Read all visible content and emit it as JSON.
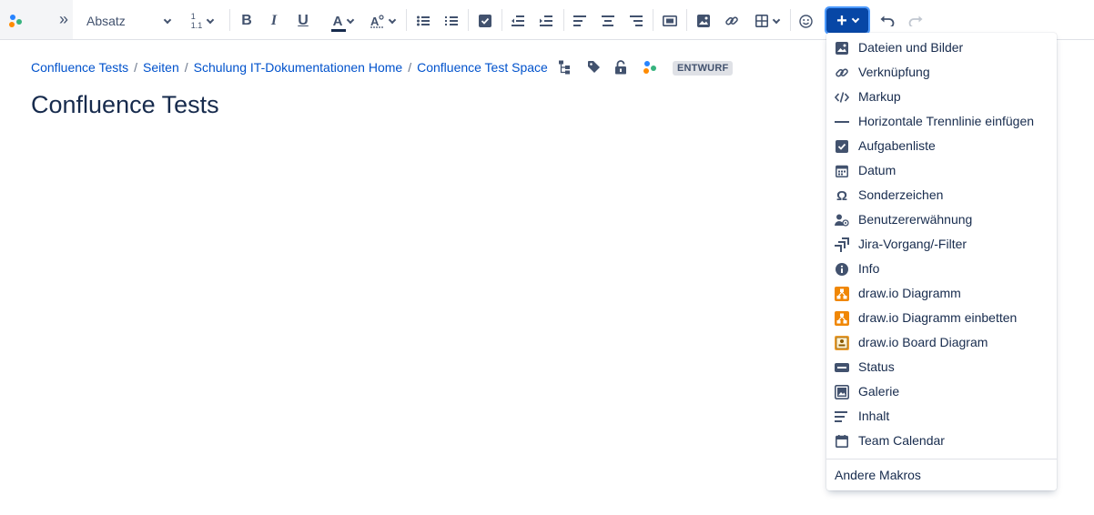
{
  "toolbar": {
    "paragraph_style": "Absatz",
    "list_number_top": "1",
    "list_number_bottom": "1.1",
    "bold": "B",
    "italic": "I",
    "underline": "U",
    "text_color": "A",
    "expand_glyph": "»",
    "plus_label": "+"
  },
  "breadcrumb": {
    "items": [
      "Confluence Tests",
      "Seiten",
      "Schulung IT-Dokumentationen Home",
      "Confluence Test Space"
    ],
    "separator": "/"
  },
  "status_badge": "ENTWURF",
  "page_title": "Confluence Tests",
  "insert_menu": {
    "items": [
      {
        "label": "Dateien und Bilder",
        "icon": "image-icon"
      },
      {
        "label": "Verknüpfung",
        "icon": "link-icon"
      },
      {
        "label": "Markup",
        "icon": "code-icon"
      },
      {
        "label": "Horizontale Trennlinie einfügen",
        "icon": "horizontal-rule-icon"
      },
      {
        "label": "Aufgabenliste",
        "icon": "checkbox-icon"
      },
      {
        "label": "Datum",
        "icon": "calendar-icon"
      },
      {
        "label": "Sonderzeichen",
        "icon": "omega-icon"
      },
      {
        "label": "Benutzererwähnung",
        "icon": "mention-icon"
      },
      {
        "label": "Jira-Vorgang/-Filter",
        "icon": "jira-icon"
      },
      {
        "label": "Info",
        "icon": "info-icon"
      },
      {
        "label": "draw.io Diagramm",
        "icon": "drawio-icon"
      },
      {
        "label": "draw.io Diagramm einbetten",
        "icon": "drawio-embed-icon"
      },
      {
        "label": "draw.io Board Diagram",
        "icon": "drawio-board-icon"
      },
      {
        "label": "Status",
        "icon": "status-icon"
      },
      {
        "label": "Galerie",
        "icon": "gallery-icon"
      },
      {
        "label": "Inhalt",
        "icon": "toc-icon"
      },
      {
        "label": "Team Calendar",
        "icon": "team-calendar-icon"
      }
    ],
    "footer": "Andere Makros"
  },
  "colors": {
    "link": "#0052cc",
    "primary": "#0747a6",
    "text": "#172b4d",
    "icon": "#42526e",
    "drawio_orange": "#f08705"
  }
}
